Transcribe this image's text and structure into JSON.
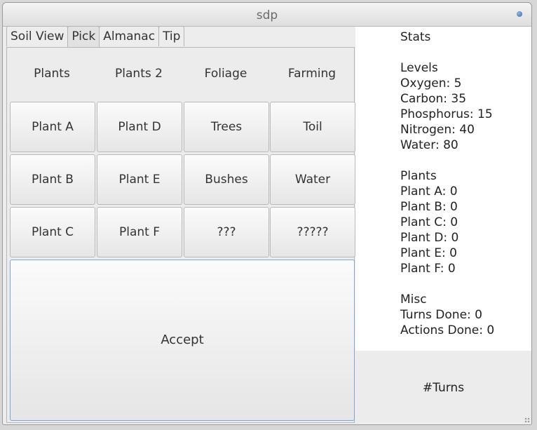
{
  "window": {
    "title": "sdp"
  },
  "tabs": [
    {
      "label": "Soil View"
    },
    {
      "label": "Pick",
      "active": true
    },
    {
      "label": "Almanac"
    },
    {
      "label": "Tip"
    }
  ],
  "pick": {
    "headers": [
      "Plants",
      "Plants 2",
      "Foliage",
      "Farming"
    ],
    "rows": [
      [
        "Plant A",
        "Plant D",
        "Trees",
        "Toil"
      ],
      [
        "Plant B",
        "Plant E",
        "Bushes",
        "Water"
      ],
      [
        "Plant C",
        "Plant F",
        "???",
        "?????"
      ]
    ],
    "accept_label": "Accept"
  },
  "stats": {
    "title": "Stats",
    "levels_heading": "Levels",
    "levels": [
      "Oxygen: 5",
      "Carbon: 35",
      "Phosphorus: 15",
      "Nitrogen: 40",
      "Water: 80"
    ],
    "plants_heading": "Plants",
    "plants": [
      "Plant A: 0",
      "Plant B: 0",
      "Plant C: 0",
      "Plant D: 0",
      "Plant E: 0",
      "Plant F: 0"
    ],
    "misc_heading": "Misc",
    "misc": [
      "Turns Done: 0",
      "Actions Done: 0"
    ]
  },
  "turns_label": "#Turns",
  "colors": {
    "window_bg": "#ededed",
    "stats_bg": "#ffffff",
    "accept_focus_border": "#7fa6d3"
  }
}
